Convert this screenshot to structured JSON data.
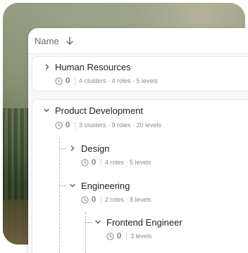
{
  "header": {
    "column_label": "Name"
  },
  "rows": [
    {
      "name": "Human Resources",
      "count": "0",
      "detail": "4 clusters · 4 roles · 5 levels"
    },
    {
      "name": "Product Development",
      "count": "0",
      "detail": "3 clusters · 9 roles · 20 levels"
    },
    {
      "name": "Design",
      "count": "0",
      "detail": "4 roles · 5 levels"
    },
    {
      "name": "Engineering",
      "count": "0",
      "detail": "2 roles · 8 levels"
    },
    {
      "name": "Frontend Engineer",
      "count": "0",
      "detail": "3 levels"
    }
  ]
}
